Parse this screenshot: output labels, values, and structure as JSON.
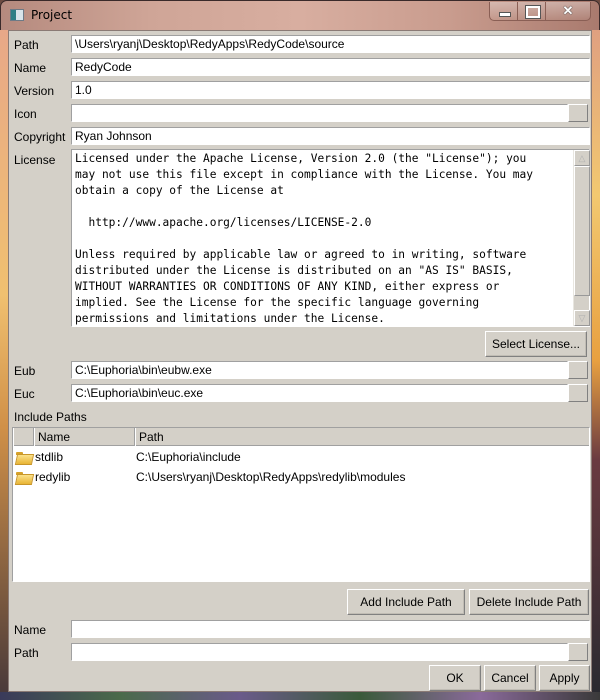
{
  "window": {
    "title": "Project",
    "controls": {
      "minimize": "minimize",
      "maximize": "maximize",
      "close": "✕"
    }
  },
  "form": {
    "path": {
      "label": "Path",
      "value": "\\Users\\ryanj\\Desktop\\RedyApps\\RedyCode\\source"
    },
    "name": {
      "label": "Name",
      "value": "RedyCode"
    },
    "version": {
      "label": "Version",
      "value": "1.0"
    },
    "icon": {
      "label": "Icon",
      "value": ""
    },
    "copyright": {
      "label": "Copyright",
      "value": "Ryan Johnson"
    },
    "license": {
      "label": "License",
      "value": "Licensed under the Apache License, Version 2.0 (the \"License\"); you\nmay not use this file except in compliance with the License. You may\nobtain a copy of the License at\n\n  http://www.apache.org/licenses/LICENSE-2.0\n\nUnless required by applicable law or agreed to in writing, software\ndistributed under the License is distributed on an \"AS IS\" BASIS,\nWITHOUT WARRANTIES OR CONDITIONS OF ANY KIND, either express or\nimplied. See the License for the specific language governing\npermissions and limitations under the License.",
      "scroll_up": "△",
      "scroll_down": "▽"
    },
    "select_license_label": "Select License...",
    "eub": {
      "label": "Eub",
      "value": "C:\\Euphoria\\bin\\eubw.exe"
    },
    "euc": {
      "label": "Euc",
      "value": "C:\\Euphoria\\bin\\euc.exe"
    }
  },
  "include_paths": {
    "label": "Include Paths",
    "columns": [
      "",
      "Name",
      "Path"
    ],
    "rows": [
      {
        "icon": "folder-icon",
        "name": "stdlib",
        "path": "C:\\Euphoria\\include"
      },
      {
        "icon": "folder-icon",
        "name": "redylib",
        "path": "C:\\Users\\ryanj\\Desktop\\RedyApps\\redylib\\modules"
      }
    ],
    "add_label": "Add Include Path",
    "delete_label": "Delete Include Path",
    "name_field": {
      "label": "Name",
      "value": ""
    },
    "path_field": {
      "label": "Path",
      "value": ""
    }
  },
  "footer": {
    "ok_label": "OK",
    "cancel_label": "Cancel",
    "apply_label": "Apply"
  }
}
